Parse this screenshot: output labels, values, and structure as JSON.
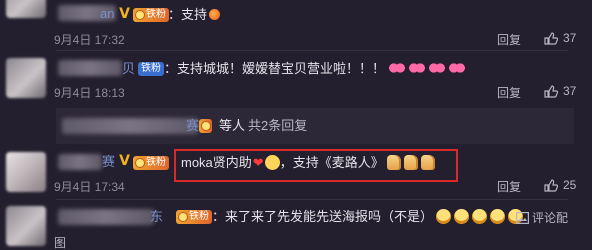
{
  "comments": [
    {
      "name_visible": "an",
      "fan_badge": "铁粉",
      "text": "：支持",
      "emoji": [
        "orange-emoji"
      ],
      "date": "9月4日 17:32",
      "reply_label": "回复",
      "likes": "37"
    },
    {
      "name_visible": "贝",
      "fan_badge": "铁粉",
      "text": "：支持城城！嫒嫒替宝贝营业啦！！！",
      "emoji": [
        "bow-emoji",
        "bow-emoji",
        "bow-emoji",
        "bow-emoji"
      ],
      "date": "9月4日 18:13",
      "reply_label": "回复",
      "likes": "37"
    },
    {
      "name_visible": "赛",
      "fan_badge": "铁粉",
      "text_prefix": "moka贤内助",
      "text": "，支持《麦路人》",
      "emoji": [
        "heart-emoji",
        "face-emoji",
        "thumbs-up-emoji",
        "thumbs-up-emoji",
        "thumbs-up-emoji"
      ],
      "date": "9月4日 17:34",
      "reply_label": "回复",
      "likes": "25"
    },
    {
      "name_visible": "东",
      "fan_badge": "铁粉",
      "text": "：来了来了先发能先送海报吗（不是）",
      "emoji": [
        "laugh-emoji",
        "laugh-emoji",
        "laugh-emoji",
        "laugh-emoji",
        "laugh-emoji"
      ],
      "action_label": "评论配",
      "trailing": "图"
    }
  ],
  "replies_bar": {
    "suffix": "等人",
    "count": "共2条回复"
  },
  "colors": {
    "background": "#231f2e",
    "highlight_border": "#d92a2a",
    "vip": "#f3b21c",
    "fan_badge": "#e8762c"
  }
}
